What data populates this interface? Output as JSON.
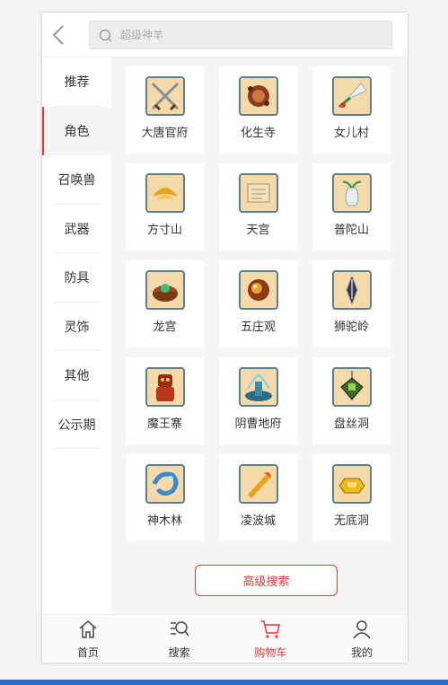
{
  "search": {
    "placeholder": "超级神羊"
  },
  "sidebar": {
    "items": [
      {
        "label": "推荐"
      },
      {
        "label": "角色"
      },
      {
        "label": "召唤兽"
      },
      {
        "label": "武器"
      },
      {
        "label": "防具"
      },
      {
        "label": "灵饰"
      },
      {
        "label": "其他"
      },
      {
        "label": "公示期"
      }
    ],
    "active_index": 1
  },
  "grid": {
    "items": [
      {
        "label": "大唐官府",
        "icon": "crossed-swords-icon"
      },
      {
        "label": "化生寺",
        "icon": "prayer-beads-icon"
      },
      {
        "label": "女儿村",
        "icon": "feather-fan-icon"
      },
      {
        "label": "方寸山",
        "icon": "golden-wing-icon"
      },
      {
        "label": "天宫",
        "icon": "scroll-icon"
      },
      {
        "label": "普陀山",
        "icon": "vase-icon"
      },
      {
        "label": "龙宫",
        "icon": "pearl-chest-icon"
      },
      {
        "label": "五庄观",
        "icon": "golden-orb-icon"
      },
      {
        "label": "狮驼岭",
        "icon": "dagger-icon"
      },
      {
        "label": "魔王寨",
        "icon": "red-totem-icon"
      },
      {
        "label": "阴曹地府",
        "icon": "fountain-icon"
      },
      {
        "label": "盘丝洞",
        "icon": "lantern-icon"
      },
      {
        "label": "神木林",
        "icon": "blue-dragon-icon"
      },
      {
        "label": "凌波城",
        "icon": "golden-flame-icon"
      },
      {
        "label": "无底洞",
        "icon": "gold-ingot-icon"
      }
    ]
  },
  "advanced_search": {
    "label": "高级搜索"
  },
  "tabbar": {
    "items": [
      {
        "label": "首页",
        "icon": "home-icon"
      },
      {
        "label": "搜索",
        "icon": "search-list-icon"
      },
      {
        "label": "购物车",
        "icon": "cart-icon"
      },
      {
        "label": "我的",
        "icon": "user-icon"
      }
    ],
    "active_index": 2
  },
  "colors": {
    "accent": "#e03838",
    "icon_bg": "#f5d9a8",
    "icon_border": "#5a7f95"
  }
}
